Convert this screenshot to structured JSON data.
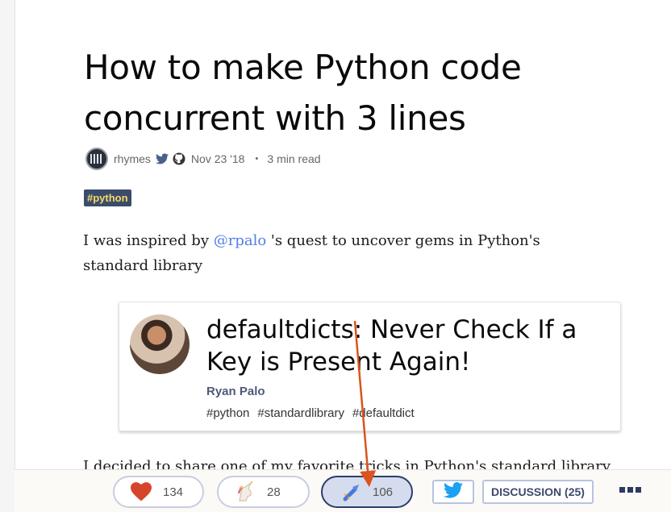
{
  "article": {
    "title": "How to make Python code concurrent with 3 lines",
    "author": "rhymes",
    "date": "Nov 23 '18",
    "separator": "・",
    "read_time": "3 min read",
    "tag": "#python",
    "intro": {
      "before": "I was inspired by ",
      "mention": "@rpalo",
      "after": " 's quest to uncover gems in Python's standard library"
    },
    "embed": {
      "title": "defaultdicts: Never Check If a Key is Present Again!",
      "author": "Ryan Palo",
      "tags": [
        "#python",
        "#standardlibrary",
        "#defaultdict"
      ]
    },
    "next_paragraph": "I decided to share one of my favorite tricks in Python's standard library"
  },
  "reactions": {
    "heart": {
      "count": "134",
      "icon": "heart-icon"
    },
    "unicorn": {
      "count": "28",
      "icon": "unicorn-icon"
    },
    "bookmark": {
      "count": "106",
      "icon": "bookmark-icon"
    }
  },
  "actions": {
    "twitter_icon": "twitter-icon",
    "discussion_label": "DISCUSSION (25)",
    "more_icon": "more-icon"
  },
  "colors": {
    "heart": "#d6452a",
    "tag_bg": "#3b4c6b",
    "tag_text": "#f7d96a",
    "mention": "#557de8",
    "annotation_arrow": "#d9541e",
    "twitter": "#1da1f2"
  }
}
